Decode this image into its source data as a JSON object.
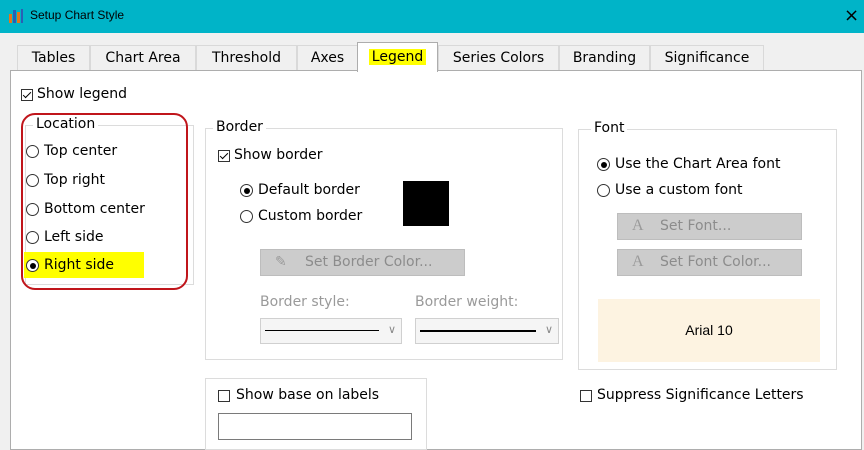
{
  "window": {
    "title": "Setup Chart Style",
    "close": "×"
  },
  "tabs": [
    {
      "label": "Tables"
    },
    {
      "label": "Chart Area"
    },
    {
      "label": "Threshold"
    },
    {
      "label": "Axes"
    },
    {
      "label": "Legend",
      "active": true
    },
    {
      "label": "Series Colors"
    },
    {
      "label": "Branding"
    },
    {
      "label": "Significance"
    }
  ],
  "legend": {
    "show_legend": {
      "label": "Show legend",
      "checked": true
    },
    "location": {
      "title": "Location",
      "options": [
        {
          "label": "Top center",
          "selected": false
        },
        {
          "label": "Top right",
          "selected": false
        },
        {
          "label": "Bottom center",
          "selected": false
        },
        {
          "label": "Left side",
          "selected": false
        },
        {
          "label": "Right side",
          "selected": true
        }
      ]
    },
    "border": {
      "title": "Border",
      "show_border": {
        "label": "Show border",
        "checked": true
      },
      "default_border": {
        "label": "Default border",
        "selected": true
      },
      "custom_border": {
        "label": "Custom border",
        "selected": false
      },
      "swatch_color": "#000000",
      "set_border_color": "Set Border Color...",
      "border_style_label": "Border style:",
      "border_weight_label": "Border weight:"
    },
    "font": {
      "title": "Font",
      "use_chart_area_font": {
        "label": "Use the Chart Area font",
        "selected": true
      },
      "use_custom_font": {
        "label": "Use a custom font",
        "selected": false
      },
      "set_font": "Set Font...",
      "set_font_color": "Set Font Color...",
      "preview_text": "Arial 10",
      "preview_bg": "#fdf3e1"
    },
    "show_base_on_labels": {
      "label": "Show base on labels",
      "checked": false,
      "value": ""
    },
    "suppress_significance": {
      "label": "Suppress Significance Letters",
      "checked": false
    }
  },
  "colors": {
    "titlebar": "#00b4c8",
    "highlight": "#ffff00",
    "annotation_red": "#c0151b"
  }
}
